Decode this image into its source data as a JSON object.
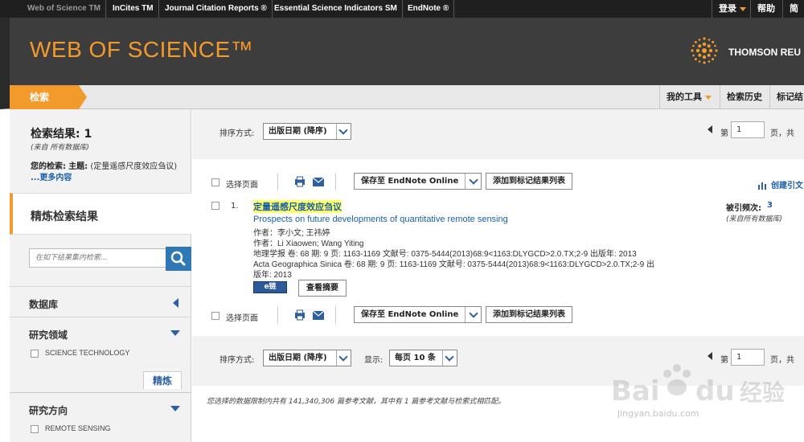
{
  "top_products": [
    "Web of Science TM",
    "InCites TM",
    "Journal Citation Reports ®",
    "Essential Science Indicators SM",
    "EndNote ®"
  ],
  "top_right": {
    "login": "登录",
    "help": "帮助",
    "lang": "简体"
  },
  "header": {
    "title": "WEB OF SCIENCE™",
    "brand": "THOMSON REU"
  },
  "nav": {
    "search_tab": "检索",
    "my_tools": "我的工具",
    "history": "检索历史",
    "marked": "标记结"
  },
  "sidebar": {
    "results_title": "检索结果: 1",
    "results_sub": "(来自 所有数据库)",
    "query_label": "您的检索:",
    "query_topic": "主题:",
    "query_text": "(定量遥感尺度效应刍议)",
    "query_more": "...更多内容",
    "refine_title": "精炼检索结果",
    "refine_placeholder": "在如下结果集内检索...",
    "database_label": "数据库",
    "research_area_label": "研究领域",
    "research_area_item": "SCIENCE TECHNOLOGY",
    "refine_button": "精炼",
    "research_direction_label": "研究方向",
    "research_direction_item": "REMOTE SENSING"
  },
  "sort_top": {
    "label": "排序方式:",
    "value": "出版日期 (降序)",
    "page_label": "第",
    "page_value": "1",
    "page_suffix": "页，共"
  },
  "toolbar": {
    "select_page": "选择页面",
    "save_endnote": "保存至 EndNote Online",
    "add_marked": "添加到标记结果列表",
    "create_citation": "创建引文"
  },
  "record": {
    "index": "1.",
    "title_cn": "定量遥感尺度效应刍议",
    "title_en": "Prospects on future developments of quantitative remote sensing",
    "authors_cn": "作者：李小文; 王祎婷",
    "authors_en": "作者：Li Xiaowen; Wang Yiting",
    "source_cn": "地理学报  卷: 68   期: 9   页: 1163-1169    文献号: 0375-5444(2013)68:9<1163:DLYGCD>2.0.TX;2-9   出版年: 2013",
    "source_en": "Acta Geographica Sinica  卷: 68   期: 9   页: 1163-1169    文献号: 0375-5444(2013)68:9<1163:DLYGCD>2.0.TX;2-9   出",
    "source_en2": "版年: 2013",
    "link_badge": "e链",
    "view_abstract": "查看摘要",
    "cited_label": "被引频次:",
    "cited_count": "3",
    "cited_sub": "(来自所有数据库)"
  },
  "sort_bottom": {
    "label": "排序方式:",
    "value": "出版日期 (降序)",
    "show_label": "显示:",
    "show_value": "每页 10 条",
    "page_label": "第",
    "page_value": "1",
    "page_suffix": "页，共"
  },
  "footnote": "您选择的数据限制内共有 141,340,306 篇参考文献，其中有 1 篇参考文献与检索式相匹配。",
  "watermark": "jingyan.baidu.com",
  "colors": {
    "accent": "#f39a2c",
    "link": "#1a5fa8",
    "header_bg": "#3d3d3d"
  }
}
